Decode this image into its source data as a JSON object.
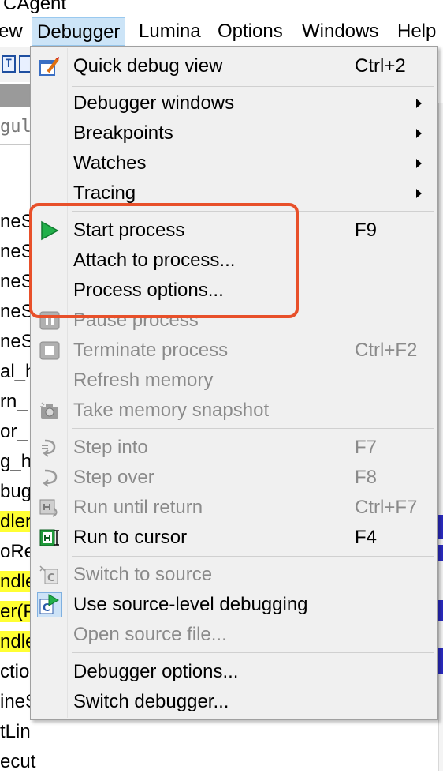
{
  "window": {
    "title_fragment": "CAgent"
  },
  "menubar": {
    "items": [
      {
        "label": "ew"
      },
      {
        "label": "Debugger",
        "active": true
      },
      {
        "label": "Lumina"
      },
      {
        "label": "Options"
      },
      {
        "label": "Windows"
      },
      {
        "label": "Help"
      }
    ]
  },
  "background": {
    "toolbar_icon_glyph": "T",
    "regular_fragment": "gula",
    "code_lines": [
      "neS",
      "neS",
      "neS",
      "neS",
      "neS",
      "al_h",
      "rn_",
      "or_",
      "g_ha",
      "bug",
      "dler",
      "oRec",
      "ndle",
      "er(P",
      "ndle",
      "ctio",
      "ineS",
      "tLin",
      "ecut"
    ]
  },
  "debugger_menu": {
    "items": [
      {
        "label": "Quick debug view",
        "shortcut": "Ctrl+2",
        "icon": "quick-debug-view-icon",
        "enabled": true,
        "submenu": false
      },
      {
        "label": "Debugger windows",
        "shortcut": "",
        "icon": "",
        "enabled": true,
        "submenu": true
      },
      {
        "label": "Breakpoints",
        "shortcut": "",
        "icon": "",
        "enabled": true,
        "submenu": true
      },
      {
        "label": "Watches",
        "shortcut": "",
        "icon": "",
        "enabled": true,
        "submenu": true
      },
      {
        "label": "Tracing",
        "shortcut": "",
        "icon": "",
        "enabled": true,
        "submenu": true
      },
      {
        "label": "Start process",
        "shortcut": "F9",
        "icon": "play-icon",
        "enabled": true,
        "submenu": false
      },
      {
        "label": "Attach to process...",
        "shortcut": "",
        "icon": "",
        "enabled": true,
        "submenu": false
      },
      {
        "label": "Process options...",
        "shortcut": "",
        "icon": "",
        "enabled": true,
        "submenu": false
      },
      {
        "label": "Pause process",
        "shortcut": "",
        "icon": "pause-icon",
        "enabled": false,
        "submenu": false
      },
      {
        "label": "Terminate process",
        "shortcut": "Ctrl+F2",
        "icon": "stop-icon",
        "enabled": false,
        "submenu": false
      },
      {
        "label": "Refresh memory",
        "shortcut": "",
        "icon": "",
        "enabled": false,
        "submenu": false
      },
      {
        "label": "Take memory snapshot",
        "shortcut": "",
        "icon": "camera-icon",
        "enabled": false,
        "submenu": false
      },
      {
        "label": "Step into",
        "shortcut": "F7",
        "icon": "step-into-icon",
        "enabled": false,
        "submenu": false
      },
      {
        "label": "Step over",
        "shortcut": "F8",
        "icon": "step-over-icon",
        "enabled": false,
        "submenu": false
      },
      {
        "label": "Run until return",
        "shortcut": "Ctrl+F7",
        "icon": "run-until-return-icon",
        "enabled": false,
        "submenu": false
      },
      {
        "label": "Run to cursor",
        "shortcut": "F4",
        "icon": "run-to-cursor-icon",
        "enabled": true,
        "submenu": false
      },
      {
        "label": "Switch to source",
        "shortcut": "",
        "icon": "switch-source-icon",
        "enabled": false,
        "submenu": false
      },
      {
        "label": "Use source-level debugging",
        "shortcut": "",
        "icon": "source-debug-icon",
        "enabled": true,
        "submenu": false
      },
      {
        "label": "Open source file...",
        "shortcut": "",
        "icon": "",
        "enabled": false,
        "submenu": false
      },
      {
        "label": "Debugger options...",
        "shortcut": "",
        "icon": "",
        "enabled": true,
        "submenu": false
      },
      {
        "label": "Switch debugger...",
        "shortcut": "",
        "icon": "",
        "enabled": true,
        "submenu": false
      }
    ]
  },
  "colors": {
    "highlight_box": "#e8502a",
    "menu_background": "#f0f0f0",
    "disabled_text": "#8a8a8a",
    "code_highlight": "#ffff33",
    "menubar_active": "#cce4f7"
  }
}
